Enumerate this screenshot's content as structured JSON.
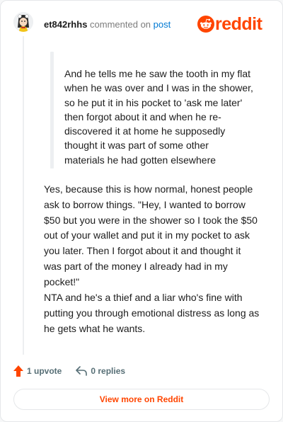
{
  "header": {
    "username": "et842rhhs",
    "commented_on": "commented on",
    "post_link": "post"
  },
  "logo": {
    "text": "reddit",
    "icon": "reddit-snoo-icon",
    "color": "#ff4500"
  },
  "comment": {
    "quote": "And he tells me he saw the tooth in my flat\nwhen he was over and I was in the shower,\nso he put it in his pocket to 'ask me later'\nthen forgot about it and when he re-\ndiscovered it at home he supposedly\nthought it was part of some other\nmaterials he had gotten elsewhere",
    "paragraphs": [
      "Yes, because this is how normal, honest people\nask to borrow things. \"Hey, I wanted to borrow\n$50 but you were in the shower so I took the $50\nout of your wallet and put it in my pocket to ask\nyou later. Then I forgot about it and thought it\nwas part of the money I already had in my\npocket!\"",
      "NTA and he's a thief and a liar who's fine with\nputting you through emotional distress as long as\nhe gets what he wants."
    ]
  },
  "actions": {
    "upvotes": "1 upvote",
    "upvote_icon": "upvote-arrow-icon",
    "replies": "0 replies",
    "reply_icon": "reply-arrow-icon"
  },
  "footer": {
    "button_label": "View more on Reddit"
  }
}
